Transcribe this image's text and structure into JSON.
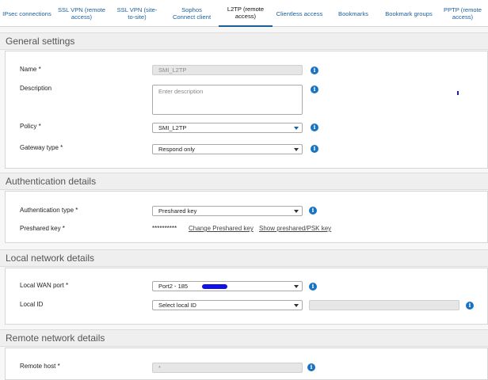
{
  "tabs": [
    {
      "label": "IPsec connections",
      "active": false
    },
    {
      "label": "SSL VPN (remote access)",
      "active": false
    },
    {
      "label": "SSL VPN (site-to-site)",
      "active": false
    },
    {
      "label": "Sophos Connect client",
      "active": false
    },
    {
      "label": "L2TP (remote access)",
      "active": true
    },
    {
      "label": "Clientless access",
      "active": false
    },
    {
      "label": "Bookmarks",
      "active": false
    },
    {
      "label": "Bookmark groups",
      "active": false
    },
    {
      "label": "PPTP (remote access)",
      "active": false
    }
  ],
  "general": {
    "title": "General settings",
    "name_label": "Name *",
    "name_value": "SMI_L2TP",
    "description_label": "Description",
    "description_placeholder": "Enter description",
    "policy_label": "Policy *",
    "policy_value": "SMI_L2TP",
    "gateway_label": "Gateway type *",
    "gateway_value": "Respond only"
  },
  "auth": {
    "title": "Authentication details",
    "type_label": "Authentication type *",
    "type_value": "Preshared key",
    "key_label": "Preshared key *",
    "key_mask": "**********",
    "change_link": "Change Preshared key",
    "show_link": "Show preshared/PSK key"
  },
  "local": {
    "title": "Local network details",
    "wan_label": "Local WAN port *",
    "wan_value": "Port2 - 185",
    "id_label": "Local ID",
    "id_value": "Select local ID"
  },
  "remote": {
    "title": "Remote network details",
    "host_label": "Remote host *",
    "host_value": "*"
  },
  "colors": {
    "accent": "#1a5e9a",
    "info_icon": "#1a73c0"
  }
}
